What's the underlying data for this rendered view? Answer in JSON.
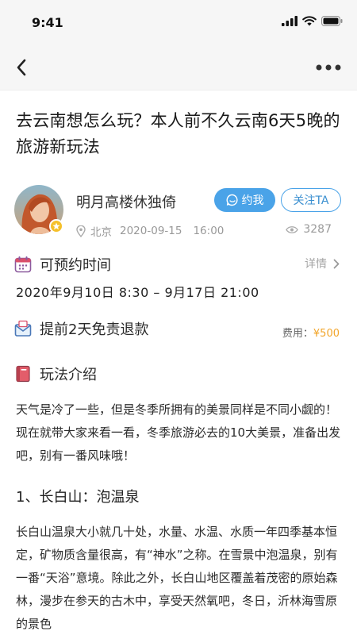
{
  "status_bar": {
    "time": "9:41"
  },
  "post": {
    "title": "去云南想怎么玩？本人前不久云南6天5晚的旅游新玩法",
    "author": {
      "name": "明月高楼休独倚",
      "location": "北京",
      "date": "2020-09-15",
      "time": "16:00"
    },
    "contact_label": "约我",
    "follow_label": "关注TA",
    "views": "3287"
  },
  "schedule": {
    "label": "可预约时间",
    "detail_label": "详情",
    "range": "2020年9月10日 8:30 – 9月17日 21:00"
  },
  "refund": {
    "label": "提前2天免责退款",
    "fee_label": "费用：",
    "fee_value": "¥500"
  },
  "intro": {
    "label": "玩法介绍",
    "paragraph1": "天气是冷了一些，但是冬季所拥有的美景同样是不同小觑的！现在就带大家来看一看，冬季旅游必去的10大美景，准备出发吧，别有一番风味哦！",
    "heading1": "1、长白山：泡温泉",
    "paragraph2": "长白山温泉大小就几十处，水量、水温、水质一年四季基本恒定，矿物质含量很高，有“神水”之称。在雪景中泡温泉，别有一番“天浴”意境。除此之外，长白山地区覆盖着茂密的原始森林，漫步在参天的古木中，享受天然氧吧，冬日，沂林海雪原的景色"
  },
  "colors": {
    "accent": "#4aa3e8",
    "price": "#f2a52a",
    "nav_bg": "#f6f6f6"
  }
}
